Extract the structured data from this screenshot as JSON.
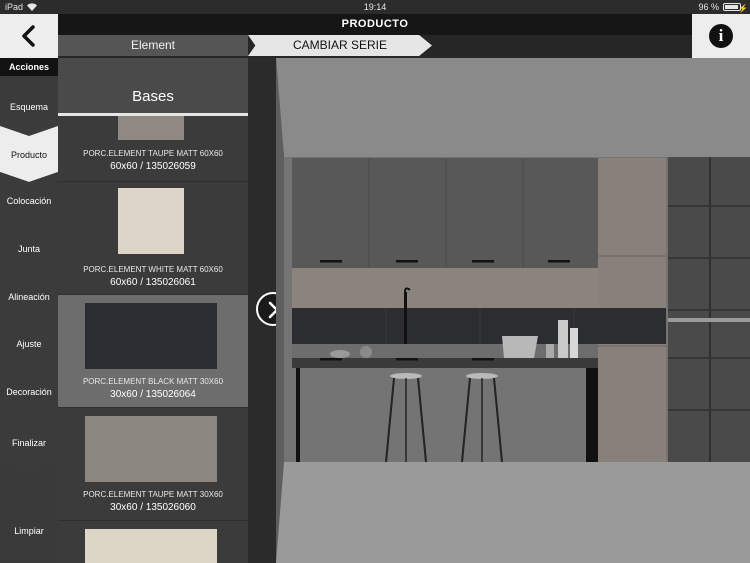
{
  "status_bar": {
    "carrier": "iPad",
    "time": "19:14",
    "battery_percent": "96 %",
    "battery_level": 0.96
  },
  "header": {
    "title": "PRODUCTO",
    "back_icon": "chevron-left-icon",
    "info_icon": "info-icon",
    "info_glyph": "i"
  },
  "breadcrumb": {
    "items": [
      "Element",
      "CAMBIAR SERIE"
    ]
  },
  "sidebar": {
    "heading": "Acciones",
    "items": [
      {
        "label": "Esquema"
      },
      {
        "label": "Producto",
        "active": true
      },
      {
        "label": "Colocación"
      },
      {
        "label": "Junta"
      },
      {
        "label": "Alineación"
      },
      {
        "label": "Ajuste"
      },
      {
        "label": "Decoración"
      },
      {
        "label": "Finalizar"
      },
      {
        "label": "Limpiar"
      }
    ]
  },
  "panel": {
    "title": "Bases",
    "products": [
      {
        "name": "PORC.ELEMENT TAUPE MATT 60X60",
        "code": "60x60 / 135026059",
        "swatch_color": "#8f8982"
      },
      {
        "name": "PORC.ELEMENT WHITE MATT 60X60",
        "code": "60x60 / 135026061",
        "swatch_color": "#ddd6c8"
      },
      {
        "name": "PORC.ELEMENT BLACK MATT 30X60",
        "code": "30x60 / 135026064",
        "swatch_color": "#2b2d33",
        "selected": true
      },
      {
        "name": "PORC.ELEMENT TAUPE MATT 30X60",
        "code": "30x60 / 135026060",
        "swatch_color": "#8c8680"
      },
      {
        "name": "",
        "code": "",
        "swatch_color": "#ddd6c6"
      }
    ]
  },
  "colors": {
    "accent_active": "#ededed",
    "header_bg": "#161616",
    "panel_bg": "#3b3b3b",
    "selected_row": "#6d6d6d"
  },
  "next_button": {
    "icon": "chevron-right-circle-icon"
  }
}
